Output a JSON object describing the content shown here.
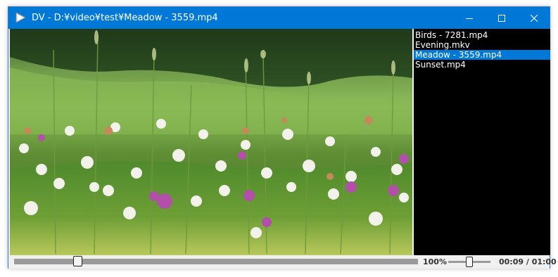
{
  "window": {
    "title": "DV - D:¥video¥test¥Meadow - 3559.mp4",
    "accent": "#0078d7"
  },
  "icons": {
    "app": "play-triangle-icon",
    "minimize": "minimize-icon",
    "maximize": "maximize-icon",
    "close": "close-icon"
  },
  "playlist": {
    "items": [
      {
        "label": "Birds - 7281.mp4"
      },
      {
        "label": "Evening.mkv"
      },
      {
        "label": "Meadow - 3559.mp4"
      },
      {
        "label": "Sunset.mp4"
      }
    ],
    "selected_index": 2
  },
  "controls": {
    "zoom": "100%",
    "time": "00:09 / 01:00",
    "seek_fraction": 0.15,
    "volume_fraction": 0.5
  }
}
